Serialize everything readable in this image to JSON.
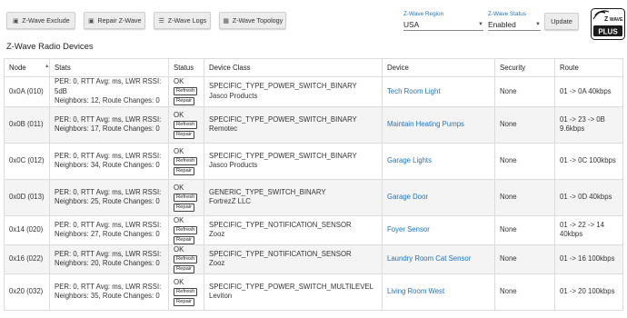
{
  "toolbar": {
    "exclude_label": "Z-Wave Exclude",
    "repair_label": "Repair Z-Wave",
    "logs_label": "Z-Wave Logs",
    "topology_label": "Z-Wave Topology"
  },
  "region": {
    "label": "Z-Wave Region",
    "value": "USA"
  },
  "zstatus": {
    "label": "Z-Wave Status",
    "value": "Enabled"
  },
  "update_label": "Update",
  "logo": {
    "top_text": "Z-WAVE",
    "bottom_text": "PLUS"
  },
  "section_title": "Z-Wave Radio Devices",
  "columns": [
    "Node",
    "Stats",
    "Status",
    "Device Class",
    "Device",
    "Security",
    "Route"
  ],
  "refresh_label": "Refresh",
  "repair_label": "Repair",
  "rows": [
    {
      "node": "0x0A (010)",
      "stats1": "PER: 0, RTT Avg: ms, LWR RSSI: 5dB",
      "stats2": "Neighbors: 12, Route Changes: 0",
      "status": "OK",
      "class1": "SPECIFIC_TYPE_POWER_SWITCH_BINARY",
      "class2": "Jasco Products",
      "device": "Tech Room Light",
      "security": "None",
      "route1": "01 -> 0A 40kbps",
      "route2": ""
    },
    {
      "node": "0x0B (011)",
      "stats1": "PER: 0, RTT Avg: ms, LWR RSSI:",
      "stats2": "Neighbors: 17, Route Changes: 0",
      "status": "OK",
      "class1": "SPECIFIC_TYPE_POWER_SWITCH_BINARY",
      "class2": "Remotec",
      "device": "Maintain Heating Pumps",
      "security": "None",
      "route1": "01 -> 23 -> 0B",
      "route2": "9.6kbps"
    },
    {
      "node": "0x0C (012)",
      "stats1": "PER: 0, RTT Avg: ms, LWR RSSI:",
      "stats2": "Neighbors: 34, Route Changes: 0",
      "status": "OK",
      "class1": "SPECIFIC_TYPE_POWER_SWITCH_BINARY",
      "class2": "Jasco Products",
      "device": "Garage Lights",
      "security": "None",
      "route1": "01 -> 0C 100kbps",
      "route2": ""
    },
    {
      "node": "0x0D (013)",
      "stats1": "PER: 0, RTT Avg: ms, LWR RSSI:",
      "stats2": "Neighbors: 25, Route Changes: 0",
      "status": "OK",
      "class1": "GENERIC_TYPE_SWITCH_BINARY",
      "class2": "FortrezZ LLC",
      "device": "Garage Door",
      "security": "None",
      "route1": "01 -> 0D 40kbps",
      "route2": ""
    },
    {
      "node": "0x14 (020)",
      "stats1": "PER: 0, RTT Avg: ms, LWR RSSI:",
      "stats2": "Neighbors: 27, Route Changes: 0",
      "status": "OK",
      "class1": "SPECIFIC_TYPE_NOTIFICATION_SENSOR",
      "class2": "Zooz",
      "device": "Foyer Sensor",
      "security": "None",
      "route1": "01 -> 22 -> 14",
      "route2": "40kbps"
    },
    {
      "node": "0x16 (022)",
      "stats1": "PER: 0, RTT Avg: ms, LWR RSSI:",
      "stats2": "Neighbors: 20, Route Changes: 0",
      "status": "OK",
      "class1": "SPECIFIC_TYPE_NOTIFICATION_SENSOR",
      "class2": "Zooz",
      "device": "Laundry Room Cat Sensor",
      "security": "None",
      "route1": "01 -> 16 100kbps",
      "route2": ""
    },
    {
      "node": "0x20 (032)",
      "stats1": "PER: 0, RTT Avg: ms, LWR RSSI:",
      "stats2": "Neighbors: 35, Route Changes: 0",
      "status": "OK",
      "class1": "SPECIFIC_TYPE_POWER_SWITCH_MULTILEVEL",
      "class2": "Leviton",
      "device": "Living Room West",
      "security": "None",
      "route1": "01 -> 20 100kbps",
      "route2": ""
    }
  ]
}
